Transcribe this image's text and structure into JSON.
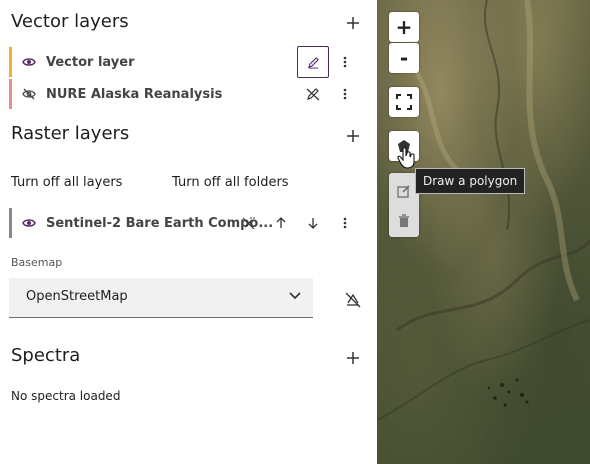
{
  "vector_layers": {
    "title": "Vector layers",
    "layers": [
      {
        "label": "Vector layer",
        "color": "#f0b030"
      },
      {
        "label": "NURE Alaska Reanalysis",
        "color": "#e88d8d"
      }
    ]
  },
  "raster_layers": {
    "title": "Raster layers",
    "turn_off_layers": "Turn off all layers",
    "turn_off_folders": "Turn off all folders",
    "layers": [
      {
        "label": "Sentinel-2 Bare Earth Compo...",
        "color": "#888888"
      }
    ]
  },
  "basemap": {
    "label": "Basemap",
    "selected": "OpenStreetMap"
  },
  "spectra": {
    "title": "Spectra",
    "empty_text": "No spectra loaded"
  },
  "map": {
    "zoom_in": "+",
    "zoom_out": "-",
    "tooltip": "Draw a polygon"
  },
  "colors": {
    "accent": "#5a2a6a",
    "highlight_border": "#4a2a5a"
  }
}
